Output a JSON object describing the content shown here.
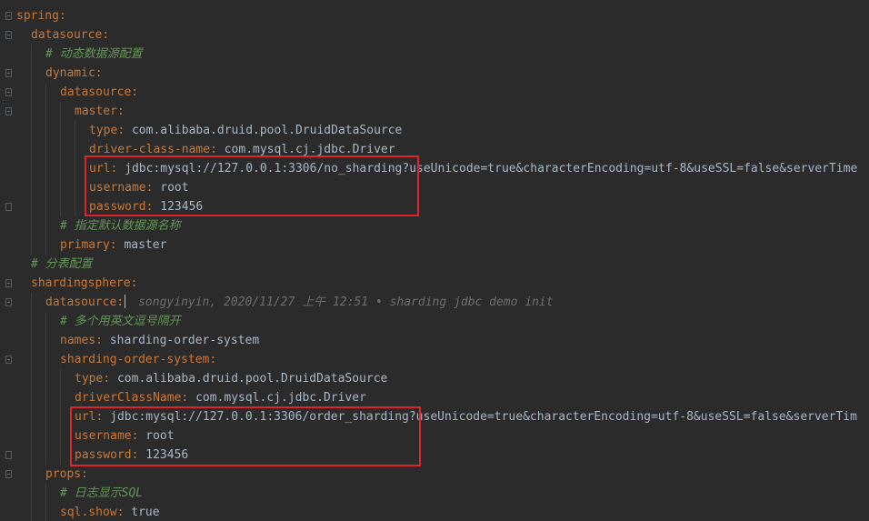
{
  "lines": [
    {
      "key": "spring",
      "sep": ":",
      "value": ""
    },
    {
      "key": "datasource",
      "sep": ":",
      "value": ""
    },
    {
      "comment": "# 动态数据源配置"
    },
    {
      "key": "dynamic",
      "sep": ":",
      "value": ""
    },
    {
      "key": "datasource",
      "sep": ":",
      "value": ""
    },
    {
      "key": "master",
      "sep": ":",
      "value": ""
    },
    {
      "key": "type",
      "sep": ": ",
      "value": "com.alibaba.druid.pool.DruidDataSource"
    },
    {
      "key": "driver-class-name",
      "sep": ": ",
      "value": "com.mysql.cj.jdbc.Driver"
    },
    {
      "key": "url",
      "sep": ": ",
      "value": "jdbc:mysql://127.0.0.1:3306/no_sharding?useUnicode=true&characterEncoding=utf-8&useSSL=false&serverTime"
    },
    {
      "key": "username",
      "sep": ": ",
      "value": "root"
    },
    {
      "key": "password",
      "sep": ": ",
      "value": "123456"
    },
    {
      "comment": "# 指定默认数据源名称"
    },
    {
      "key": "primary",
      "sep": ": ",
      "value": "master"
    },
    {
      "comment": "# 分表配置"
    },
    {
      "key": "shardingsphere",
      "sep": ":",
      "value": ""
    },
    {
      "key": "datasource",
      "sep": ":",
      "value": ""
    },
    {
      "comment": "# 多个用英文逗号隔开"
    },
    {
      "key": "names",
      "sep": ": ",
      "value": "sharding-order-system"
    },
    {
      "key": "sharding-order-system",
      "sep": ":",
      "value": ""
    },
    {
      "key": "type",
      "sep": ": ",
      "value": "com.alibaba.druid.pool.DruidDataSource"
    },
    {
      "key": "driverClassName",
      "sep": ": ",
      "value": "com.mysql.cj.jdbc.Driver"
    },
    {
      "key": "url",
      "sep": ": ",
      "value": "jdbc:mysql://127.0.0.1:3306/order_sharding?useUnicode=true&characterEncoding=utf-8&useSSL=false&serverTim"
    },
    {
      "key": "username",
      "sep": ": ",
      "value": "root"
    },
    {
      "key": "password",
      "sep": ": ",
      "value": "123456"
    },
    {
      "key": "props",
      "sep": ":",
      "value": ""
    },
    {
      "comment": "# 日志显示SQL"
    },
    {
      "key": "sql.show",
      "sep": ": ",
      "value": "true"
    }
  ],
  "blame": "songyinyin, 2020/11/27 上午 12:51 • sharding jdbc demo init",
  "colors": {
    "background": "#2b2b2b",
    "key": "#cc7832",
    "value": "#a9b7c6",
    "comment": "#629755",
    "highlight_border": "#e0242b"
  }
}
